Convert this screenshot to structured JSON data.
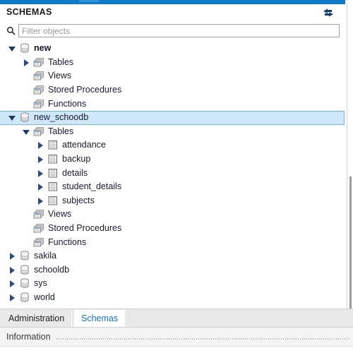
{
  "window": {
    "accent_color": "#0f7ac7"
  },
  "header": {
    "title": "SCHEMAS",
    "refresh_icon": "refresh-icon"
  },
  "filter": {
    "icon": "search-icon",
    "value": "",
    "placeholder": "Filter objects"
  },
  "tree": {
    "selected_color": "#cfe7fa",
    "nodes": [
      {
        "label": "new",
        "icon": "database-icon",
        "level": 0,
        "state": "expanded",
        "bold": true,
        "selected": false
      },
      {
        "label": "Tables",
        "icon": "folder-icon",
        "level": 1,
        "state": "collapsed",
        "bold": false,
        "selected": false
      },
      {
        "label": "Views",
        "icon": "folder-icon",
        "level": 1,
        "state": "none",
        "bold": false,
        "selected": false
      },
      {
        "label": "Stored Procedures",
        "icon": "folder-icon",
        "level": 1,
        "state": "none",
        "bold": false,
        "selected": false
      },
      {
        "label": "Functions",
        "icon": "folder-icon",
        "level": 1,
        "state": "none",
        "bold": false,
        "selected": false
      },
      {
        "label": "new_schoodb",
        "icon": "database-icon",
        "level": 0,
        "state": "expanded",
        "bold": false,
        "selected": true
      },
      {
        "label": "Tables",
        "icon": "folder-icon",
        "level": 1,
        "state": "expanded",
        "bold": false,
        "selected": false
      },
      {
        "label": "attendance",
        "icon": "table-icon",
        "level": 2,
        "state": "collapsed",
        "bold": false,
        "selected": false
      },
      {
        "label": "backup",
        "icon": "table-icon",
        "level": 2,
        "state": "collapsed",
        "bold": false,
        "selected": false
      },
      {
        "label": "details",
        "icon": "table-icon",
        "level": 2,
        "state": "collapsed",
        "bold": false,
        "selected": false
      },
      {
        "label": "student_details",
        "icon": "table-icon",
        "level": 2,
        "state": "collapsed",
        "bold": false,
        "selected": false
      },
      {
        "label": "subjects",
        "icon": "table-icon",
        "level": 2,
        "state": "collapsed",
        "bold": false,
        "selected": false
      },
      {
        "label": "Views",
        "icon": "folder-icon",
        "level": 1,
        "state": "none",
        "bold": false,
        "selected": false
      },
      {
        "label": "Stored Procedures",
        "icon": "folder-icon",
        "level": 1,
        "state": "none",
        "bold": false,
        "selected": false
      },
      {
        "label": "Functions",
        "icon": "folder-icon",
        "level": 1,
        "state": "none",
        "bold": false,
        "selected": false
      },
      {
        "label": "sakila",
        "icon": "database-icon",
        "level": 0,
        "state": "collapsed",
        "bold": false,
        "selected": false
      },
      {
        "label": "schooldb",
        "icon": "database-icon",
        "level": 0,
        "state": "collapsed",
        "bold": false,
        "selected": false
      },
      {
        "label": "sys",
        "icon": "database-icon",
        "level": 0,
        "state": "collapsed",
        "bold": false,
        "selected": false
      },
      {
        "label": "world",
        "icon": "database-icon",
        "level": 0,
        "state": "collapsed",
        "bold": false,
        "selected": false
      }
    ]
  },
  "tabs": {
    "items": [
      {
        "label": "Administration",
        "active": false
      },
      {
        "label": "Schemas",
        "active": true
      }
    ],
    "active_color": "#1473c4"
  },
  "status": {
    "label": "Information"
  }
}
